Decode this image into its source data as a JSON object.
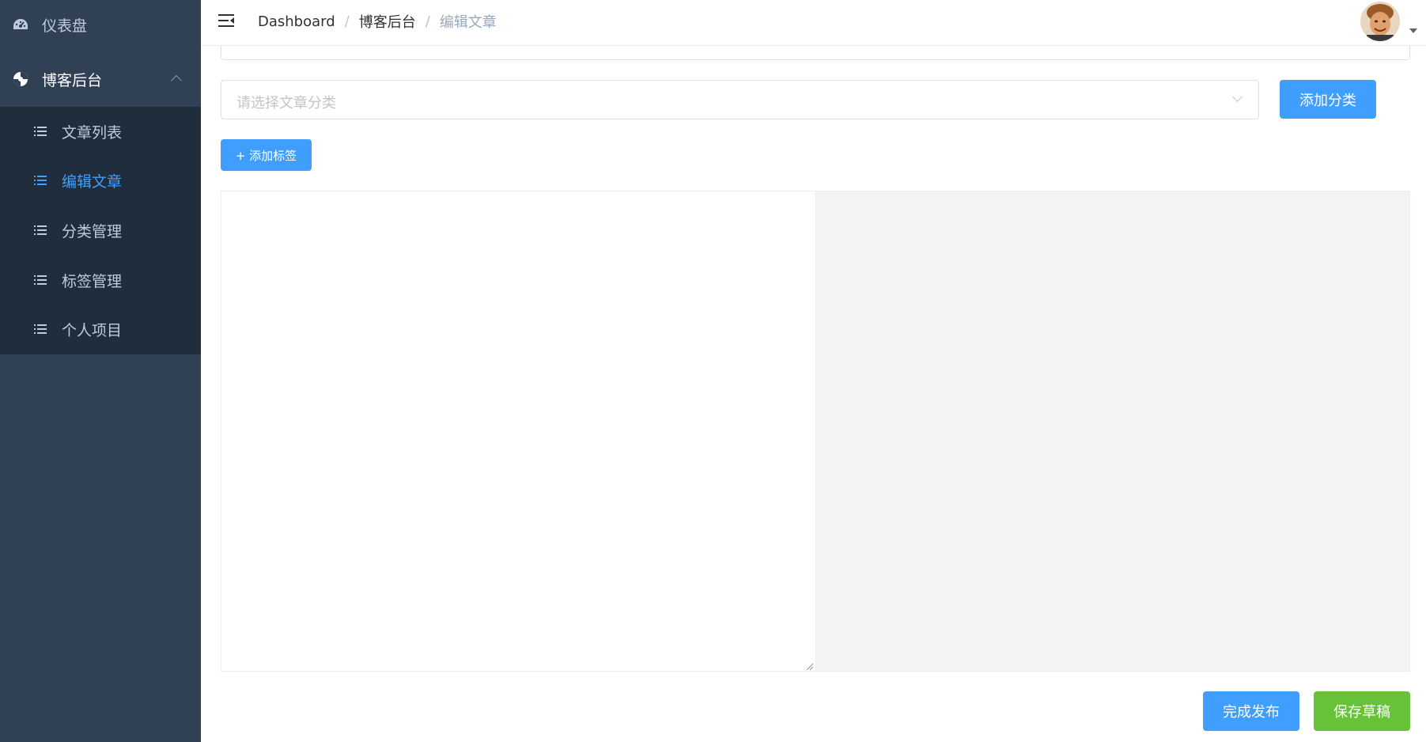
{
  "sidebar": {
    "dashboard": {
      "label": "仪表盘",
      "icon": "dashboard-icon"
    },
    "blog": {
      "label": "博客后台",
      "icon": "pinwheel-icon",
      "expanded": true
    },
    "items": [
      {
        "label": "文章列表",
        "icon": "list-icon"
      },
      {
        "label": "编辑文章",
        "icon": "list-icon",
        "active": true
      },
      {
        "label": "分类管理",
        "icon": "list-icon"
      },
      {
        "label": "标签管理",
        "icon": "list-icon"
      },
      {
        "label": "个人项目",
        "icon": "list-icon"
      }
    ],
    "colors": {
      "background": "#304156",
      "submenu_background": "#1f2d3d",
      "text": "#bfcbd9",
      "active": "#409eff"
    }
  },
  "navbar": {
    "breadcrumb": [
      "Dashboard",
      "博客后台",
      "编辑文章"
    ],
    "separator": "/",
    "avatar": "user-avatar"
  },
  "form": {
    "category_select": {
      "placeholder": "请选择文章分类",
      "value": ""
    },
    "add_category_label": "添加分类",
    "add_tag_label": "+ 添加标签"
  },
  "footer": {
    "publish_label": "完成发布",
    "save_draft_label": "保存草稿"
  },
  "colors": {
    "primary": "#409eff",
    "success": "#67c23a",
    "preview_bg": "#f4f4f4"
  }
}
